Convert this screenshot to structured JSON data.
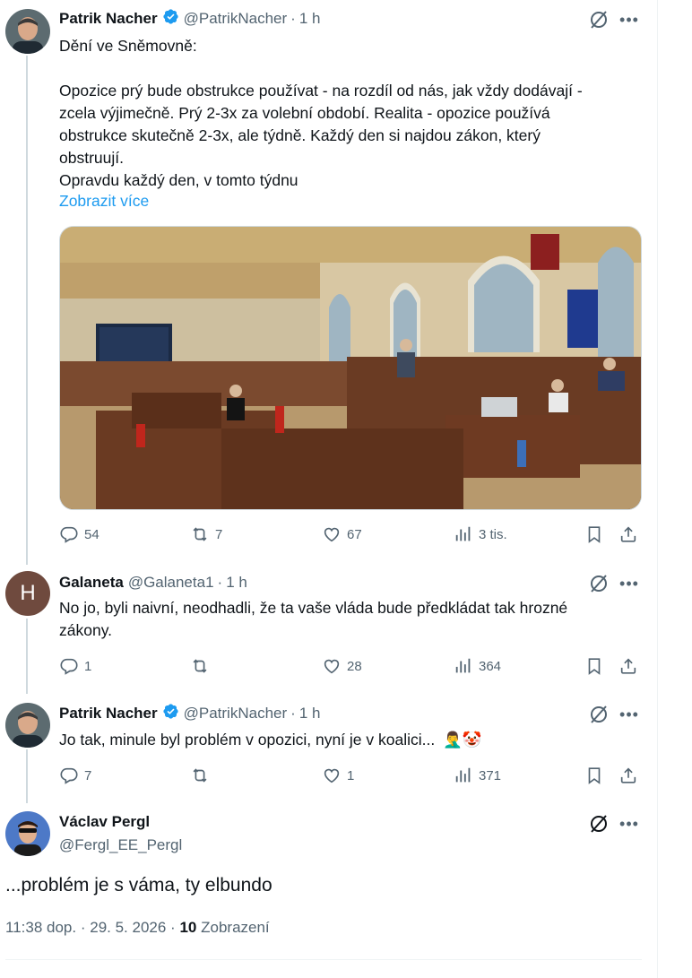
{
  "tweets": [
    {
      "name": "Patrik Nacher",
      "handle": "@PatrikNacher",
      "dot": "·",
      "time": "1 h",
      "lines": [
        "Dění ve Sněmovně:",
        "",
        "Opozice prý bude obstrukce používat - na rozdíl od nás, jak vždy dodávají -",
        "zcela výjimečně. Prý 2-3x za volební období. Realita - opozice používá",
        "obstrukce skutečně 2-3x, ale týdně. Každý den si najdou zákon, který",
        "obstruují.",
        "Opravdu každý den, v tomto týdnu"
      ],
      "show_more": "Zobrazit více",
      "replies": "54",
      "reposts": "7",
      "likes": "67",
      "views": "3 tis."
    },
    {
      "avatar_letter": "H",
      "name": "Galaneta",
      "handle": "@Galaneta1",
      "dot": "·",
      "time": "1 h",
      "lines": [
        "No jo, byli naivní, neodhadli, že ta vaše vláda bude předkládat tak hrozné",
        "zákony."
      ],
      "replies": "1",
      "reposts": "",
      "likes": "28",
      "views": "364"
    },
    {
      "name": "Patrik Nacher",
      "handle": "@PatrikNacher",
      "dot": "·",
      "time": "1 h",
      "text": "Jo tak, minule byl problém v opozici, nyní je v koalici...",
      "emojis": "🤦‍♂️🤡",
      "replies": "7",
      "reposts": "",
      "likes": "1",
      "views": "371"
    }
  ],
  "main": {
    "name": "Václav Pergl",
    "handle": "@Fergl_EE_Pergl",
    "text": "...problém je s vámа, ty elbundo",
    "time": "11:38 dop.",
    "date": "29. 5. 2026",
    "sep": "·",
    "views_count": "10",
    "views_label": "Zobrazení"
  },
  "colors": {
    "verified": "#1d9bf0",
    "link": "#1d9bf0",
    "muted": "#536471"
  },
  "icons": [
    "verified-badge-icon",
    "grok-icon",
    "more-icon",
    "reply-icon",
    "repost-icon",
    "like-icon",
    "views-icon",
    "bookmark-icon",
    "share-icon"
  ]
}
